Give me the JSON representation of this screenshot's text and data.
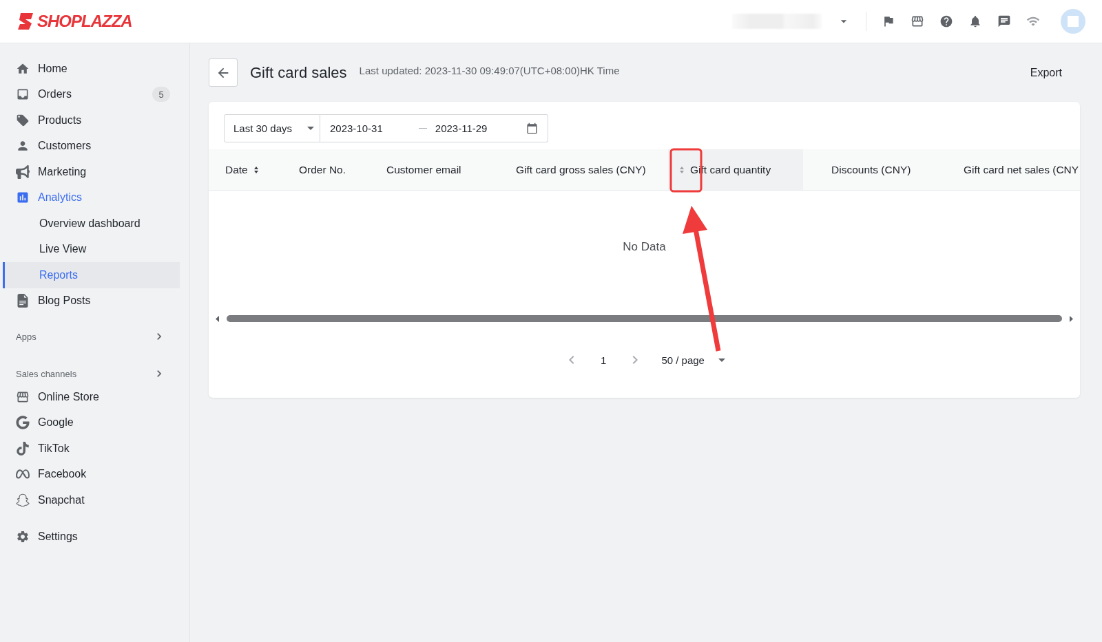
{
  "logo": "SHOPLAZZA",
  "sidebar": {
    "items": [
      {
        "label": "Home",
        "selected": false
      },
      {
        "label": "Orders",
        "selected": false,
        "badge": "5"
      },
      {
        "label": "Products",
        "selected": false
      },
      {
        "label": "Customers",
        "selected": false
      },
      {
        "label": "Marketing",
        "selected": false
      },
      {
        "label": "Analytics",
        "selected": true,
        "children": [
          {
            "label": "Overview dashboard",
            "selected": false
          },
          {
            "label": "Live View",
            "selected": false
          },
          {
            "label": "Reports",
            "selected": true
          }
        ]
      },
      {
        "label": "Blog Posts",
        "selected": false
      }
    ],
    "sections": [
      {
        "label": "Apps"
      },
      {
        "label": "Sales channels",
        "items": [
          {
            "label": "Online Store",
            "selected": false
          },
          {
            "label": "Google",
            "selected": false
          },
          {
            "label": "TikTok",
            "selected": false
          },
          {
            "label": "Facebook",
            "selected": false
          },
          {
            "label": "Snapchat",
            "selected": false
          }
        ]
      }
    ],
    "settings": {
      "label": "Settings",
      "selected": false
    }
  },
  "page": {
    "title": "Gift card sales",
    "last_updated": "Last updated: 2023-11-30 09:49:07(UTC+08:00)HK Time",
    "export": "Export"
  },
  "filters": {
    "range": "Last 30 days",
    "start": "2023-10-31",
    "end": "2023-11-29"
  },
  "table": {
    "columns": [
      {
        "label": "Date",
        "sortable": true,
        "selected": false
      },
      {
        "label": "Order No.",
        "sortable": false,
        "selected": false
      },
      {
        "label": "Customer email",
        "sortable": false,
        "selected": false
      },
      {
        "label": "Gift card gross sales (CNY)",
        "sortable": false,
        "selected": false
      },
      {
        "label": "Gift card quantity",
        "sortable": true,
        "selected": true
      },
      {
        "label": "Discounts (CNY)",
        "sortable": false,
        "selected": false
      },
      {
        "label": "Gift card net sales (CNY",
        "sortable": false,
        "selected": false
      }
    ],
    "empty": "No Data"
  },
  "pagination": {
    "page": "1",
    "page_size": "50 / page"
  }
}
